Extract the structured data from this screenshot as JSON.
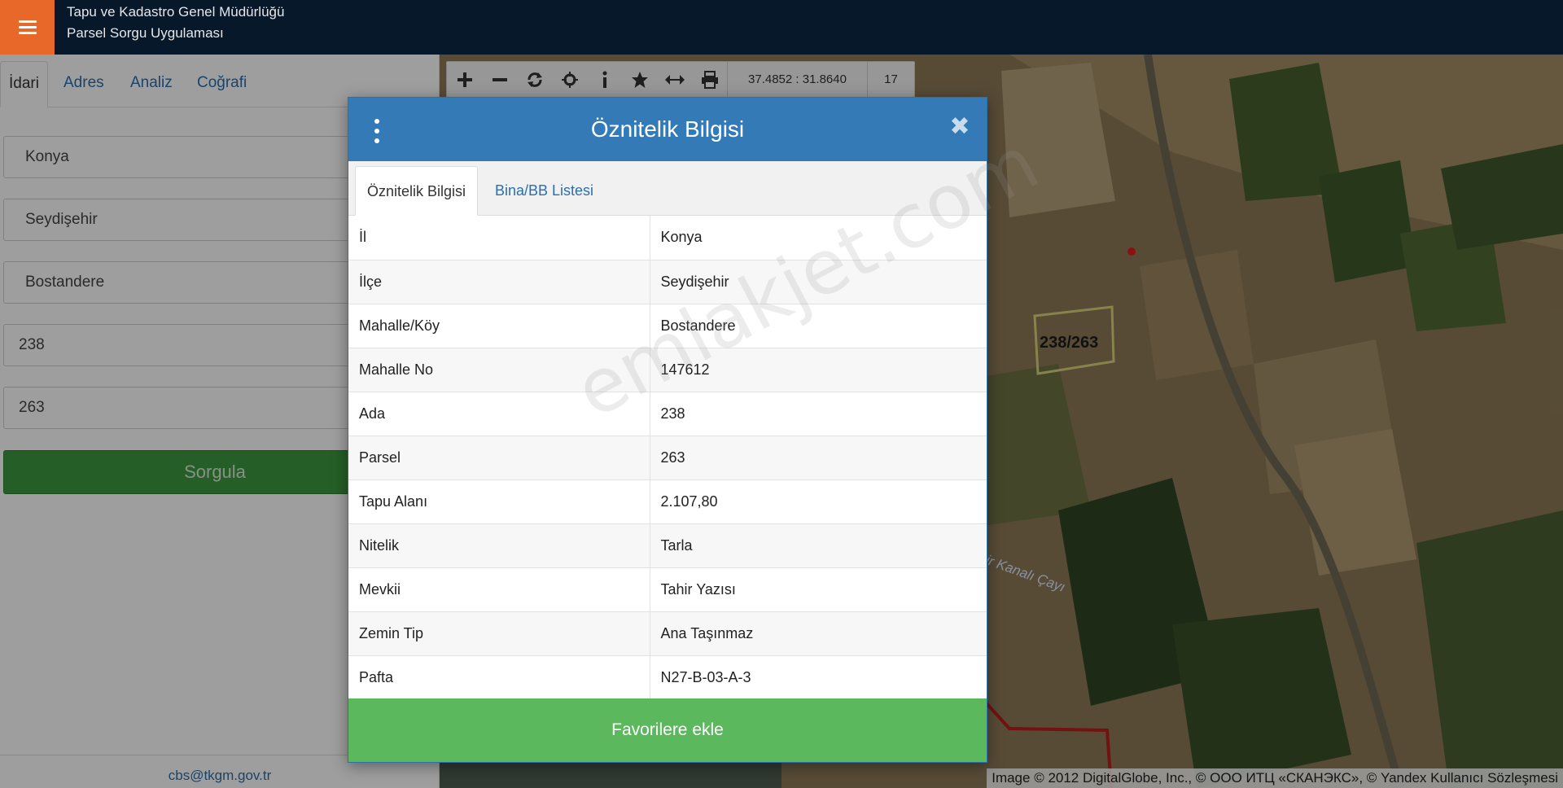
{
  "header": {
    "title_line1": "Tapu ve Kadastro Genel Müdürlüğü",
    "title_line2": "Parsel Sorgu Uygulaması"
  },
  "left_panel": {
    "tabs": [
      "İdari",
      "Adres",
      "Analiz",
      "Coğrafi"
    ],
    "fields": {
      "il": "Konya",
      "ilce": "Seydişehir",
      "mahalle": "Bostandere",
      "ada": "238",
      "parsel": "263"
    },
    "search_label": "Sorgula",
    "footer_email": "cbs@tkgm.gov.tr"
  },
  "map": {
    "toolbar_icons": [
      "zoom-in-icon",
      "zoom-out-icon",
      "refresh-icon",
      "locate-icon",
      "info-icon",
      "star-icon",
      "measure-icon",
      "print-icon"
    ],
    "coordinates": "37.4852 : 31.8640",
    "zoom_level": "17",
    "parcel_label": "238/263",
    "canal_label": "hir Kanalı Çayı",
    "attribution": "Image © 2012 DigitalGlobe, Inc., © ООО ИТЦ «СКАНЭКС», © Yandex Kullanıcı Sözleşmesi"
  },
  "modal": {
    "title": "Öznitelik Bilgisi",
    "tabs": [
      "Öznitelik Bilgisi",
      "Bina/BB Listesi"
    ],
    "rows": [
      {
        "key": "İl",
        "value": "Konya"
      },
      {
        "key": "İlçe",
        "value": "Seydişehir"
      },
      {
        "key": "Mahalle/Köy",
        "value": "Bostandere"
      },
      {
        "key": "Mahalle No",
        "value": "147612"
      },
      {
        "key": "Ada",
        "value": "238"
      },
      {
        "key": "Parsel",
        "value": "263"
      },
      {
        "key": "Tapu Alanı",
        "value": "2.107,80"
      },
      {
        "key": "Nitelik",
        "value": "Tarla"
      },
      {
        "key": "Mevkii",
        "value": "Tahir Yazısı"
      },
      {
        "key": "Zemin Tip",
        "value": "Ana Taşınmaz"
      },
      {
        "key": "Pafta",
        "value": "N27-B-03-A-3"
      }
    ],
    "favorite_label": "Favorilere ekle"
  },
  "watermark": "emlakjet.com",
  "colors": {
    "header_bg": "#06182a",
    "menu_accent": "#e8682a",
    "modal_header": "#337ab7",
    "favorite_button": "#5cb85c",
    "search_button": "#3d9a3f"
  }
}
